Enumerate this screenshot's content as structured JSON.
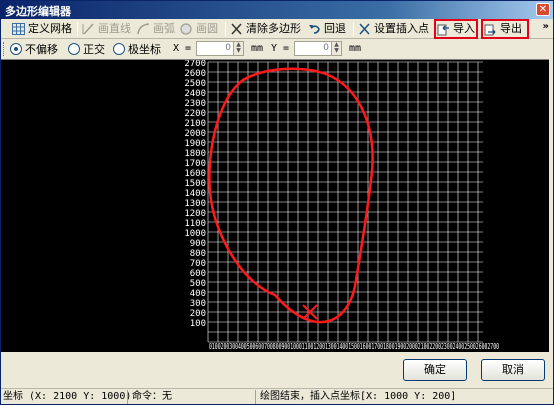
{
  "window": {
    "title": "多边形编辑器",
    "close_glyph": "✕"
  },
  "toolbar": {
    "define_grid": "定义网格",
    "draw_line": "画直线",
    "draw_arc": "画弧",
    "draw_circle": "画圆",
    "clear_polygon": "清除多边形",
    "undo": "回退",
    "set_insert_point": "设置插入点",
    "import": "导入",
    "export": "导出",
    "more": "»"
  },
  "options": {
    "no_offset": "不偏移",
    "orthogonal": "正交",
    "polar": "极坐标",
    "x_label": "X =",
    "x_value": "0",
    "x_unit": "mm",
    "y_label": "Y =",
    "y_value": "0",
    "y_unit": "mm"
  },
  "grid": {
    "y_ticks": [
      "2700",
      "2600",
      "2500",
      "2400",
      "2300",
      "2200",
      "2100",
      "2000",
      "1900",
      "1800",
      "1700",
      "1600",
      "1500",
      "1400",
      "1300",
      "1200",
      "1100",
      "1000",
      "900",
      "800",
      "700",
      "600",
      "500",
      "400",
      "300",
      "200",
      "100"
    ],
    "x_tick_text": "0100200300400500600700800900100011001200130014001500160017001800190020002100220023002400250026002700",
    "insert_point": {
      "x": 1000,
      "y": 200
    }
  },
  "buttons": {
    "ok": "确定",
    "cancel": "取消"
  },
  "status": {
    "coords": "坐标 (X: 2100 Y: 1000)",
    "command": "命令：无",
    "message": "绘图结束，插入点坐标[X: 1000 Y: 200]"
  },
  "colors": {
    "shape": "#ff1a1a",
    "grid": "#ffffff",
    "highlight": "#e3001b"
  }
}
